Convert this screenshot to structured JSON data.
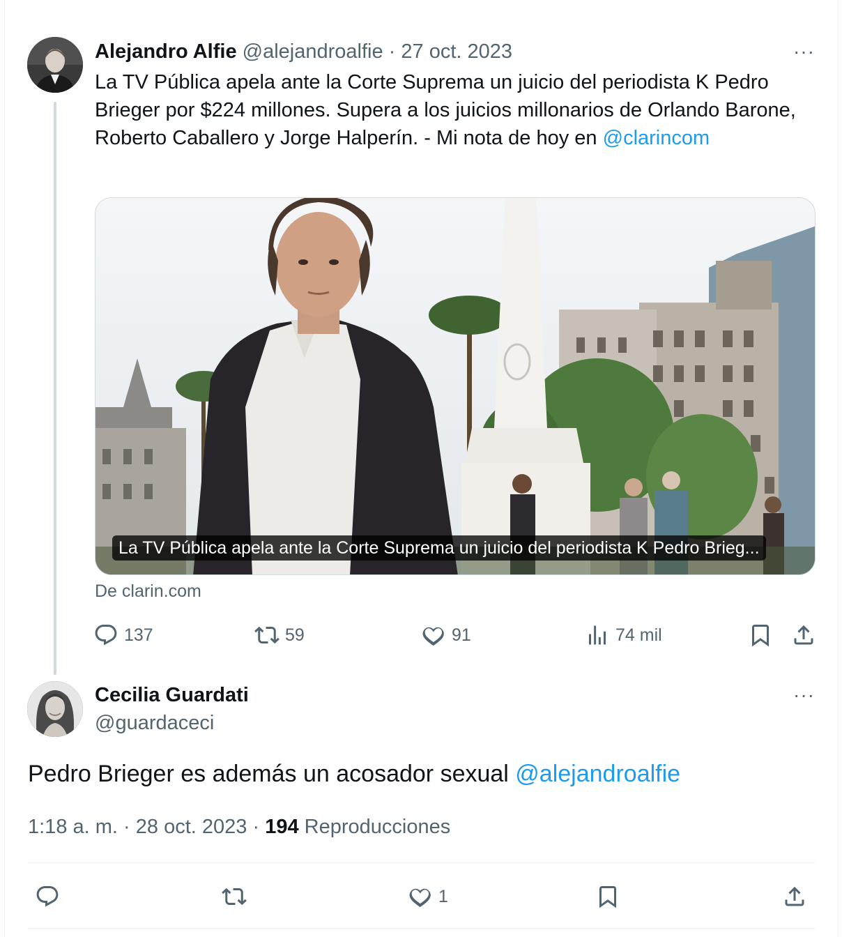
{
  "tweet1": {
    "display_name": "Alejandro Alfie",
    "handle": "@alejandroalfie",
    "separator": "·",
    "date": "27 oct. 2023",
    "more": "···",
    "text": "La TV Pública apela ante la Corte Suprema un juicio del periodista K Pedro Brieger por $224 millones. Supera a los juicios millonarios de Orlando Barone, Roberto Caballero y Jorge Halperín. - Mi nota de hoy en ",
    "mention": "@clarincom",
    "card": {
      "caption": "La TV Pública apela ante la Corte Suprema un juicio del periodista K Pedro Brieg...",
      "source": "De clarin.com"
    },
    "actions": {
      "replies": "137",
      "retweets": "59",
      "likes": "91",
      "views": "74 mil"
    }
  },
  "tweet2": {
    "display_name": "Cecilia Guardati",
    "handle": "@guardaceci",
    "more": "···",
    "text": "Pedro Brieger es además un acosador sexual ",
    "mention": "@alejandroalfie",
    "meta": {
      "time": "1:18 a. m.",
      "separator": "·",
      "date": "28 oct. 2023",
      "views_count": "194",
      "views_label": "Reproducciones"
    },
    "actions": {
      "likes": "1"
    }
  },
  "colors": {
    "link": "#1d9bf0",
    "secondary_text": "#536471",
    "primary_text": "#0f1419",
    "border": "#cfd9de"
  },
  "icons": [
    "more-icon",
    "reply-icon",
    "retweet-icon",
    "like-icon",
    "views-icon",
    "bookmark-icon",
    "share-icon"
  ]
}
